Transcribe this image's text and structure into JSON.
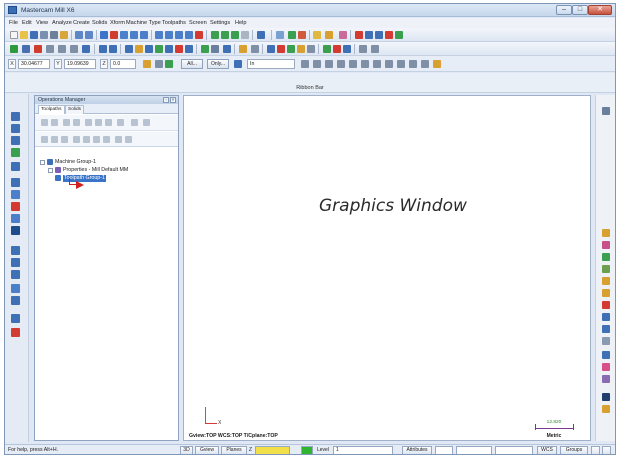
{
  "window": {
    "title": "Mastercam Mill X6",
    "minimize": "–",
    "maximize": "□",
    "close": "✕"
  },
  "menu": {
    "items": [
      "File",
      "Edit",
      "View",
      "Analyze",
      "Create",
      "Solids",
      "Xform",
      "Machine Type",
      "Toolpaths",
      "Screen",
      "Settings",
      "Help"
    ]
  },
  "coordbar": {
    "x_label": "X",
    "x_value": "30.04677",
    "y_label": "Y",
    "y_value": "19.09639",
    "z_label": "Z",
    "z_value": "0.0",
    "all_button": "All...",
    "only_button": "Only...",
    "mode_value": "In"
  },
  "ribbon": {
    "label": "Ribbon Bar"
  },
  "operations_manager": {
    "title": "Operations Manager",
    "pin": "‑",
    "close": "×",
    "tabs": [
      "Toolpaths",
      "Solids"
    ],
    "tree": {
      "machine_group": "Machine Group-1",
      "properties": "Properties - Mill Default MM",
      "toolpath_group": "Toolpath Group-1"
    }
  },
  "graphics": {
    "label": "Graphics Window",
    "axis_label": "X",
    "view_info": "Gview:TOP   WCS:TOP   T/Cplane:TOP",
    "scale_value": "12.820",
    "scale_unit": "Metric"
  },
  "statusbar": {
    "help_text": "For help, press Alt+H.",
    "mode_3d": "3D",
    "gview": "Gview",
    "planes": "Planes",
    "z_label": "Z",
    "level_label": "Level",
    "level_value": "1",
    "attributes": "Attributes",
    "wcs": "WCS",
    "groups": "Groups"
  },
  "colors": {
    "accent_blue": "#3a74c8",
    "insert_arrow_red": "#d21f1f",
    "scale_green": "#2e8b2e",
    "scale_purple": "#7a3a92",
    "level_green": "#2fb52f",
    "z_yellow": "#f2e04a"
  }
}
